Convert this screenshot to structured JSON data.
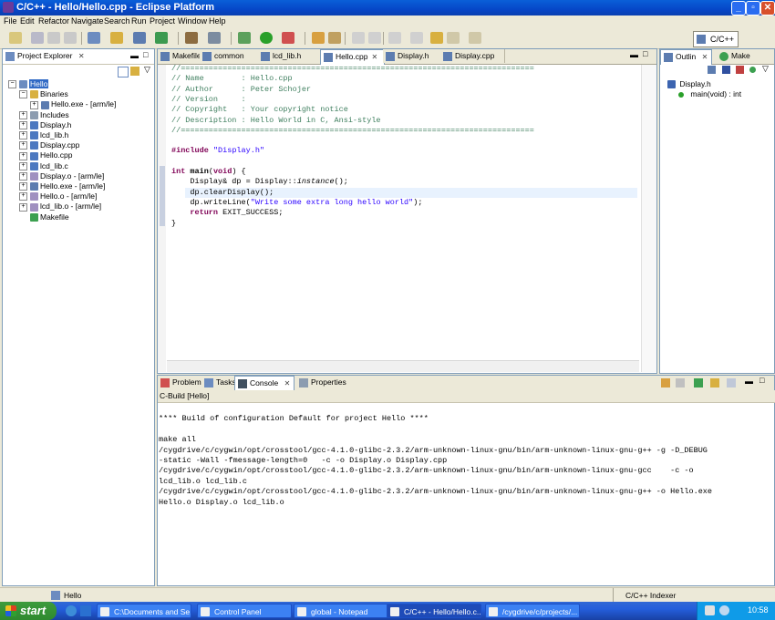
{
  "window": {
    "title": "C/C++ - Hello/Hello.cpp - Eclipse Platform"
  },
  "menu": [
    "File",
    "Edit",
    "Refactor",
    "Navigate",
    "Search",
    "Run",
    "Project",
    "Window",
    "Help"
  ],
  "perspective": {
    "label": "C/C++"
  },
  "project_explorer": {
    "title": "Project Explorer",
    "items": [
      {
        "label": "Hello",
        "depth": 0,
        "expander": "−",
        "icon": "project-icon"
      },
      {
        "label": "Binaries",
        "depth": 1,
        "expander": "−",
        "icon": "binaries-folder-icon"
      },
      {
        "label": "Hello.exe - [arm/le]",
        "depth": 2,
        "expander": "+",
        "icon": "binary-icon"
      },
      {
        "label": "Includes",
        "depth": 1,
        "expander": "+",
        "icon": "includes-icon"
      },
      {
        "label": "Display.h",
        "depth": 1,
        "expander": "+",
        "icon": "header-file-icon"
      },
      {
        "label": "lcd_lib.h",
        "depth": 1,
        "expander": "+",
        "icon": "header-file-icon"
      },
      {
        "label": "Display.cpp",
        "depth": 1,
        "expander": "+",
        "icon": "cpp-file-icon"
      },
      {
        "label": "Hello.cpp",
        "depth": 1,
        "expander": "+",
        "icon": "cpp-file-icon"
      },
      {
        "label": "lcd_lib.c",
        "depth": 1,
        "expander": "+",
        "icon": "c-file-icon"
      },
      {
        "label": "Display.o - [arm/le]",
        "depth": 1,
        "expander": "+",
        "icon": "object-file-icon"
      },
      {
        "label": "Hello.exe - [arm/le]",
        "depth": 1,
        "expander": "+",
        "icon": "binary-icon"
      },
      {
        "label": "Hello.o - [arm/le]",
        "depth": 1,
        "expander": "+",
        "icon": "object-file-icon"
      },
      {
        "label": "lcd_lib.o - [arm/le]",
        "depth": 1,
        "expander": "+",
        "icon": "object-file-icon"
      },
      {
        "label": "Makefile",
        "depth": 1,
        "expander": "",
        "icon": "makefile-icon"
      }
    ]
  },
  "editor_tabs": [
    {
      "label": "Makefile",
      "active": false
    },
    {
      "label": "common",
      "active": false
    },
    {
      "label": "lcd_lib.h",
      "active": false
    },
    {
      "label": "Hello.cpp",
      "active": true
    },
    {
      "label": "Display.h",
      "active": false
    },
    {
      "label": "Display.cpp",
      "active": false
    }
  ],
  "editor": {
    "lines": [
      "//============================================================================",
      "// Name        : Hello.cpp",
      "// Author      : Peter Schojer",
      "// Version     :",
      "// Copyright   : Your copyright notice",
      "// Description : Hello World in C, Ansi-style",
      "//============================================================================",
      "",
      "#include \"Display.h\"",
      "",
      "int main(void) {",
      "    Display& dp = Display::instance();",
      "    dp.clearDisplay();",
      "    dp.writeLine(\"Write some extra long hello world\");",
      "    return EXIT_SUCCESS;",
      "}"
    ]
  },
  "outline": {
    "tabs": [
      "Outlin",
      "Make"
    ],
    "items": [
      "Display.h",
      "main(void) : int"
    ]
  },
  "bottom_tabs": [
    "Problems",
    "Tasks",
    "Console",
    "Properties"
  ],
  "console": {
    "title": "C-Build [Hello]",
    "lines": [
      "",
      "**** Build of configuration Default for project Hello ****",
      "",
      "make all",
      "/cygdrive/c/cygwin/opt/crosstool/gcc-4.1.0-glibc-2.3.2/arm-unknown-linux-gnu/bin/arm-unknown-linux-gnu-g++ -g -D_DEBUG",
      "-static -Wall -fmessage-length=0   -c -o Display.o Display.cpp",
      "/cygdrive/c/cygwin/opt/crosstool/gcc-4.1.0-glibc-2.3.2/arm-unknown-linux-gnu/bin/arm-unknown-linux-gnu-gcc    -c -o",
      "lcd_lib.o lcd_lib.c",
      "/cygdrive/c/cygwin/opt/crosstool/gcc-4.1.0-glibc-2.3.2/arm-unknown-linux-gnu/bin/arm-unknown-linux-gnu-g++ -o Hello.exe",
      "Hello.o Display.o lcd_lib.o"
    ]
  },
  "status": {
    "left": "Hello",
    "right": "C/C++ Indexer"
  },
  "taskbar": {
    "start": "start",
    "tasks": [
      {
        "label": "C:\\Documents and Se...",
        "active": false
      },
      {
        "label": "Control Panel",
        "active": false
      },
      {
        "label": "global - Notepad",
        "active": false
      },
      {
        "label": "C/C++ - Hello/Hello.c...",
        "active": true
      },
      {
        "label": "/cygdrive/c/projects/...",
        "active": false
      }
    ],
    "clock": "10:58"
  }
}
